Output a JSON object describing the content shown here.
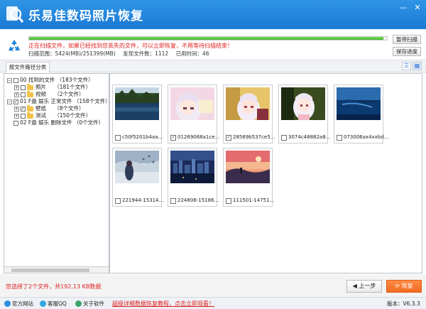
{
  "window": {
    "title": "乐易佳数码照片恢复",
    "controls": [
      "—",
      "✕"
    ]
  },
  "scan": {
    "progress_pct": 99,
    "status": "正在扫描文件，如果已经找到您丢失的文件，可以立即恢复，不用等待扫描结束！",
    "range_label": "扫描范围：5424(MB)/251399(MB)",
    "found_label": "发现文件数：1112",
    "time_label": "已用时间：46",
    "pause_button": "暂停扫描",
    "save_button": "保存进度"
  },
  "tabs": [
    "按文件路径分类"
  ],
  "tree": [
    {
      "label": "00 找到的文件 （183个文件）",
      "level": 0,
      "expander": "−",
      "checked": false,
      "folder": false
    },
    {
      "label": "照片　　（181个文件）",
      "level": 1,
      "expander": "+",
      "checked": false,
      "folder": true
    },
    {
      "label": "视频　　（2个文件）",
      "level": 1,
      "expander": "+",
      "checked": false,
      "folder": true
    },
    {
      "label": "01 F盘 娱乐 正常文件 （158个文件）",
      "level": 0,
      "expander": "−",
      "checked": true,
      "folder": false
    },
    {
      "label": "壁纸　　（8个文件）",
      "level": 1,
      "expander": "+",
      "checked": true,
      "folder": true
    },
    {
      "label": "测试　　（150个文件）",
      "level": 1,
      "expander": "+",
      "checked": false,
      "folder": true
    },
    {
      "label": "02 F盘 娱乐 删除文件 （0个文件）",
      "level": 0,
      "expander": "",
      "checked": false,
      "folder": false
    }
  ],
  "files": [
    {
      "name": "c50f5201b4aa...",
      "checked": false,
      "palette": "lake"
    },
    {
      "name": "01269068a1ce...",
      "checked": true,
      "palette": "anime-pink"
    },
    {
      "name": "28569b537ce5...",
      "checked": true,
      "palette": "anime-gold"
    },
    {
      "name": "3074c48882a8...",
      "checked": false,
      "palette": "anime-green"
    },
    {
      "name": "073006ax4xxbd...",
      "checked": false,
      "palette": "ocean"
    },
    {
      "name": "221944-15314...",
      "checked": false,
      "palette": "sky-girl"
    },
    {
      "name": "224808-15186...",
      "checked": false,
      "palette": "city"
    },
    {
      "name": "111501-14751...",
      "checked": false,
      "palette": "sunset"
    }
  ],
  "bottom": {
    "selected_text": "您选择了2个文件，共192.13 KB数据",
    "back_button": "上一步",
    "recover_button": "恢复"
  },
  "footer": {
    "links": [
      "官方网站",
      "客服QQ",
      "关于软件"
    ],
    "promo": "超级详细数据恢复教程，点击立即观看！",
    "version": "版本：V6.3.3"
  },
  "colors": {
    "titlebar": "#1f84da",
    "accent_orange": "#f06b1f",
    "warning_red": "#e02020",
    "progress_green": "#45b92c"
  }
}
